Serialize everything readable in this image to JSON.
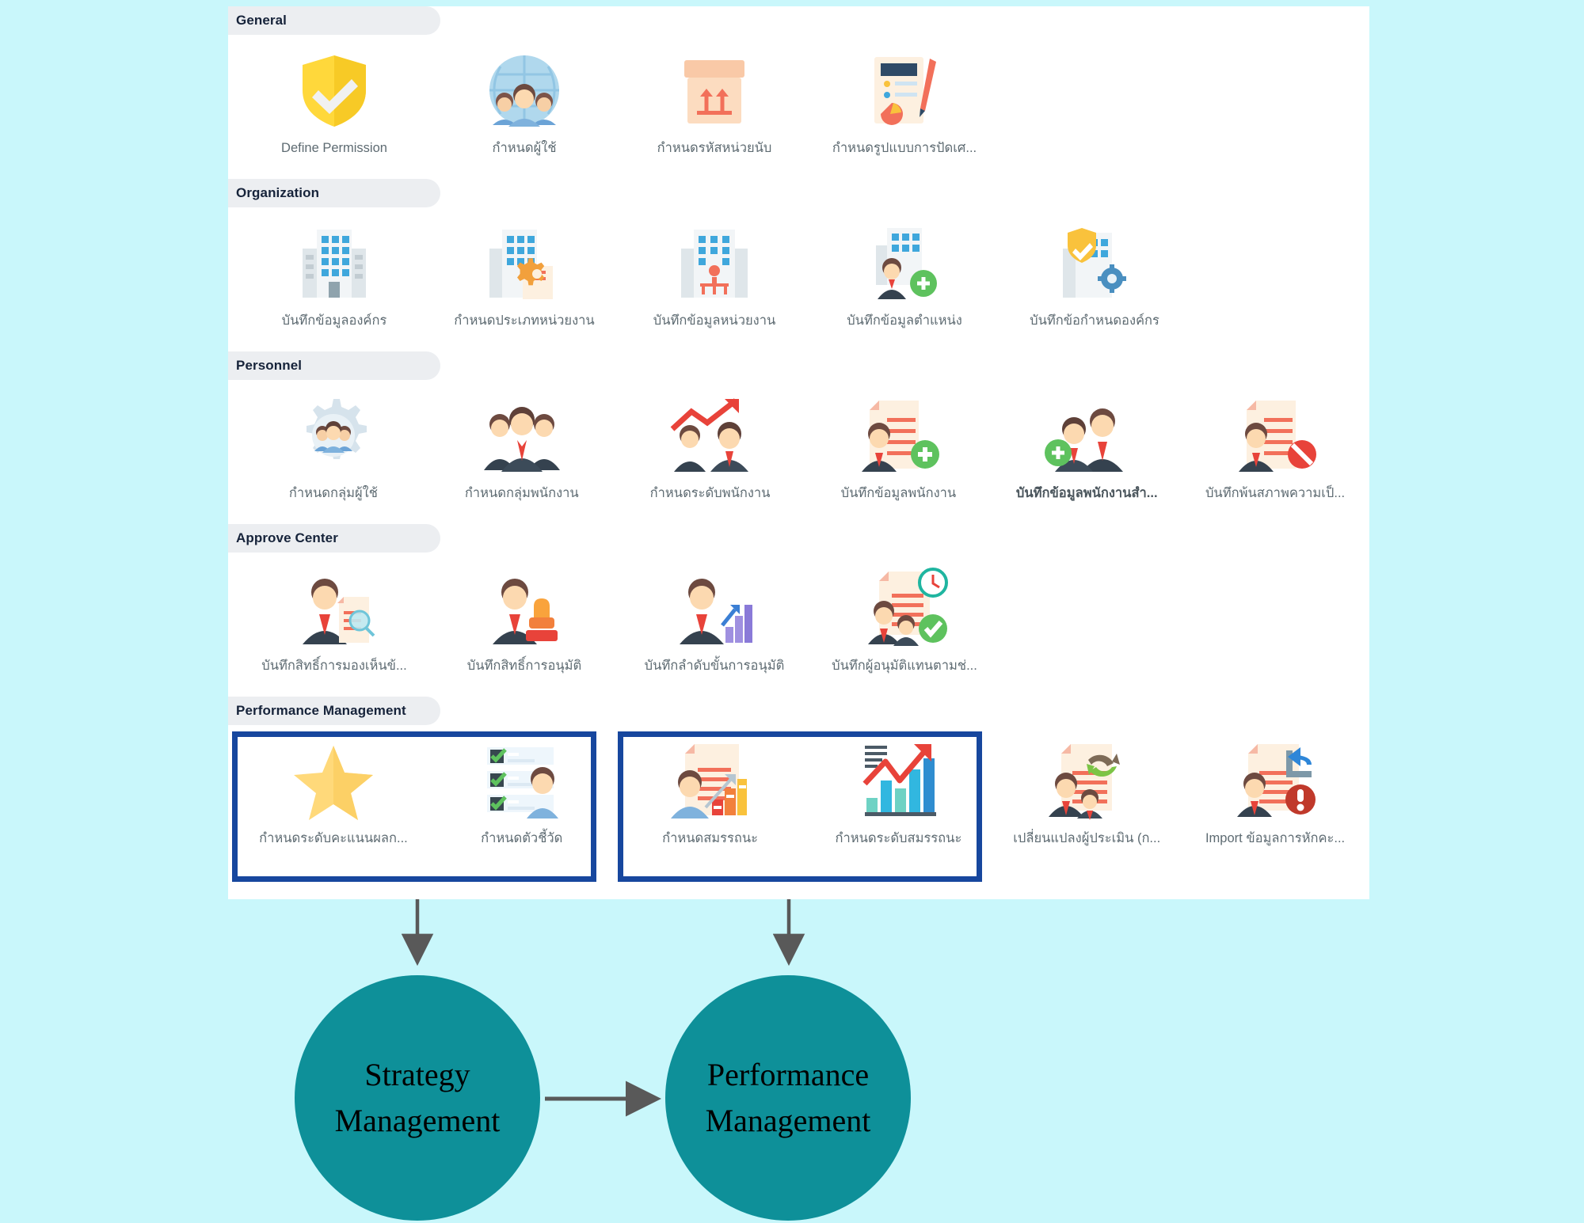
{
  "page": {
    "background_color": "#c9f7fb",
    "panel_background": "#ffffff",
    "highlight_border_color": "#17479e",
    "bubble_color": "#0e9099",
    "arrow_color": "#595959"
  },
  "sections": [
    {
      "id": "general",
      "header": "General",
      "items": [
        {
          "label": "Define  Permission",
          "icon": "shield-check-icon",
          "bold": false
        },
        {
          "label": "กำหนดผู้ใช้",
          "icon": "globe-users-icon",
          "bold": false
        },
        {
          "label": "กำหนดรหัสหน่วยนับ",
          "icon": "box-arrows-up-icon",
          "bold": false
        },
        {
          "label": "กำหนดรูปแบบการปัดเศ...",
          "icon": "document-pen-chart-icon",
          "bold": false
        }
      ]
    },
    {
      "id": "organization",
      "header": "Organization",
      "items": [
        {
          "label": "บันทึกข้อมูลองค์กร",
          "icon": "building-icon",
          "bold": false
        },
        {
          "label": "กำหนดประเภทหน่วยงาน",
          "icon": "building-gear-doc-icon",
          "bold": false
        },
        {
          "label": "บันทึกข้อมูลหน่วยงาน",
          "icon": "building-orgchart-icon",
          "bold": false
        },
        {
          "label": "บันทึกข้อมูลตำแหน่ง",
          "icon": "building-person-plus-icon",
          "bold": false
        },
        {
          "label": "บันทึกข้อกำหนดองค์กร",
          "icon": "building-shield-gear-icon",
          "bold": false
        }
      ]
    },
    {
      "id": "personnel",
      "header": "Personnel",
      "items": [
        {
          "label": "กำหนดกลุ่มผู้ใช้",
          "icon": "gear-users-icon",
          "bold": false
        },
        {
          "label": "กำหนดกลุ่มพนักงาน",
          "icon": "three-employees-icon",
          "bold": false
        },
        {
          "label": "กำหนดระดับพนักงาน",
          "icon": "employees-growth-arrow-icon",
          "bold": false
        },
        {
          "label": "บันทึกข้อมูลพนักงาน",
          "icon": "employee-document-plus-icon",
          "bold": false
        },
        {
          "label": "บันทึกข้อมูลพนักงานสำ...",
          "icon": "two-employees-plus-icon",
          "bold": true
        },
        {
          "label": "บันทึกพ้นสภาพความเป็...",
          "icon": "employee-document-block-icon",
          "bold": false
        }
      ]
    },
    {
      "id": "approve-center",
      "header": "Approve Center",
      "items": [
        {
          "label": "บันทึกสิทธิ์การมองเห็นข้...",
          "icon": "employee-document-search-icon",
          "bold": false
        },
        {
          "label": "บันทึกสิทธิ์การอนุมัติ",
          "icon": "employee-stamp-icon",
          "bold": false
        },
        {
          "label": "บันทึกลำดับขั้นการอนุมัติ",
          "icon": "employee-bar-growth-icon",
          "bold": false
        },
        {
          "label": "บันทึกผู้อนุมัติแทนตามช่...",
          "icon": "employee-document-clock-check-icon",
          "bold": false
        }
      ]
    },
    {
      "id": "performance-management",
      "header": "Performance Management",
      "items": [
        {
          "label": "กำหนดระดับคะแนนผลก...",
          "icon": "star-icon",
          "bold": false,
          "highlighted": true
        },
        {
          "label": "กำหนดตัวชี้วัด",
          "icon": "checklist-person-icon",
          "bold": false,
          "highlighted": true
        },
        {
          "label": "กำหนดสมรรถนะ",
          "icon": "employee-document-barchart-icon",
          "bold": false,
          "highlighted": true
        },
        {
          "label": "กำหนดระดับสมรรถนะ",
          "icon": "bar-chart-growth-arrow-icon",
          "bold": false,
          "highlighted": true
        },
        {
          "label": "เปลี่ยนแปลงผู้ประเมิน (ก...",
          "icon": "employees-document-refresh-icon",
          "bold": false,
          "highlighted": false
        },
        {
          "label": "Import  ข้อมูลการหักคะ...",
          "icon": "employee-document-import-alert-icon",
          "bold": false,
          "highlighted": false
        }
      ]
    }
  ],
  "annotations": {
    "bubbles": [
      {
        "id": "strategy",
        "line1": "Strategy",
        "line2": "Management"
      },
      {
        "id": "performance",
        "line1": "Performance",
        "line2": "Management"
      }
    ]
  }
}
